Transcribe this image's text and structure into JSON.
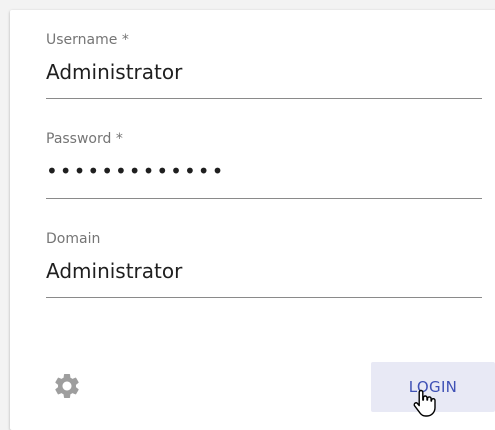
{
  "form": {
    "username": {
      "label": "Username *",
      "value": "Administrator"
    },
    "password": {
      "label": "Password *",
      "value": "•••••••••••••"
    },
    "domain": {
      "label": "Domain",
      "value": "Administrator"
    }
  },
  "actions": {
    "settings_icon": "gear-icon",
    "login_label": "LOGIN"
  },
  "colors": {
    "accent": "#3f51b5",
    "button_bg": "#e8e9f5",
    "label": "#757575",
    "underline": "#8a8a8a",
    "icon": "#9e9e9e"
  }
}
